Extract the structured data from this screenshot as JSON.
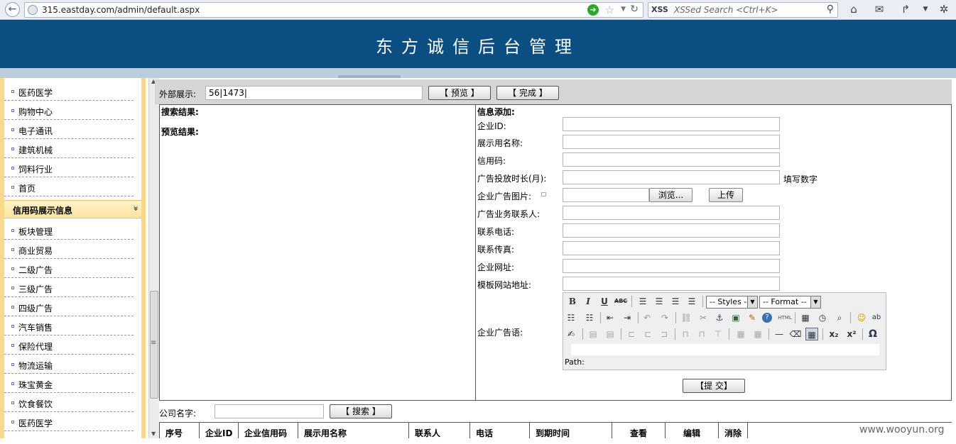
{
  "browser": {
    "back_glyph": "←",
    "url": "315.eastday.com/admin/default.aspx",
    "search_engine": "XSS",
    "search_placeholder": "XSSed Search <Ctrl+K>"
  },
  "header": {
    "title": "东方诚信后台管理"
  },
  "sidebar": {
    "items_top": [
      "医药医学",
      "购物中心",
      "电子通讯",
      "建筑机械",
      "饲料行业",
      "首页"
    ],
    "group": {
      "label": "信用码展示信息",
      "chevron": "»"
    },
    "items_bottom": [
      "板块管理",
      "商业贸易",
      "二级广告",
      "三级广告",
      "四级广告",
      "汽车销售",
      "保险代理",
      "物流运输",
      "珠宝黄金",
      "饮食餐饮",
      "医药医学"
    ]
  },
  "topbar": {
    "label": "外部展示:",
    "value": "56|1473|",
    "preview_btn": "【 预览 】",
    "done_btn": "【 完成 】"
  },
  "left_panel": {
    "search_result": "搜索结果:",
    "preview_result": "预览结果:"
  },
  "form": {
    "heading": "信息添加:",
    "labels": [
      "企业ID:",
      "展示用名称:",
      "信用码:",
      "广告投放时长(月):",
      "企业广告图片:",
      "广告业务联系人:",
      "联系电话:",
      "联系传真:",
      "企业网址:",
      "模板网站地址:"
    ],
    "duration_hint": "填写数字",
    "browse_btn": "浏览...",
    "upload_btn": "上传",
    "slogan_label": "企业广告语:",
    "submit_btn": "【提  交】"
  },
  "editor": {
    "styles_select": "-- Styles --",
    "format_select": "-- Format --",
    "path_label": "Path:",
    "glyphs": {
      "bold": "B",
      "italic": "I",
      "underline": "U",
      "strike": "ABC",
      "html": "HTML",
      "ab": "ab",
      "sub": "x₂",
      "sup": "x²",
      "omega": "Ω"
    }
  },
  "search": {
    "label": "公司名字:",
    "search_btn": "【 搜索 】"
  },
  "table": {
    "headers": [
      "序号",
      "企业ID",
      "企业信用码",
      "展示用名称",
      "联系人",
      "电话",
      "到期时间",
      "查看",
      "编辑",
      "消除"
    ]
  },
  "watermark": "www.wooyun.org",
  "colors": {
    "header_bg": "#0b4f82",
    "sidebar_border": "#f8d98a",
    "topbar_bg": "#d6d6d6"
  }
}
